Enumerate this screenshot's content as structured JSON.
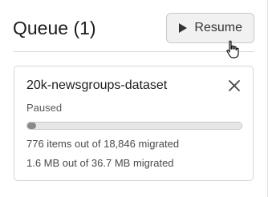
{
  "header": {
    "title": "Queue (1)",
    "resume_label": "Resume"
  },
  "queue_item": {
    "name": "20k-newsgroups-dataset",
    "status": "Paused",
    "progress_fraction": 0.0412,
    "items_text": "776 items out of 18,846 migrated",
    "size_text": "1.6 MB out of 36.7 MB migrated"
  },
  "colors": {
    "progress_fill": "#8a8a8a",
    "progress_track": "#e6e6e6",
    "button_bg": "#f1f1f1"
  },
  "icons": {
    "resume": "play-icon",
    "remove": "close-icon",
    "pointer": "hand-cursor-icon"
  }
}
